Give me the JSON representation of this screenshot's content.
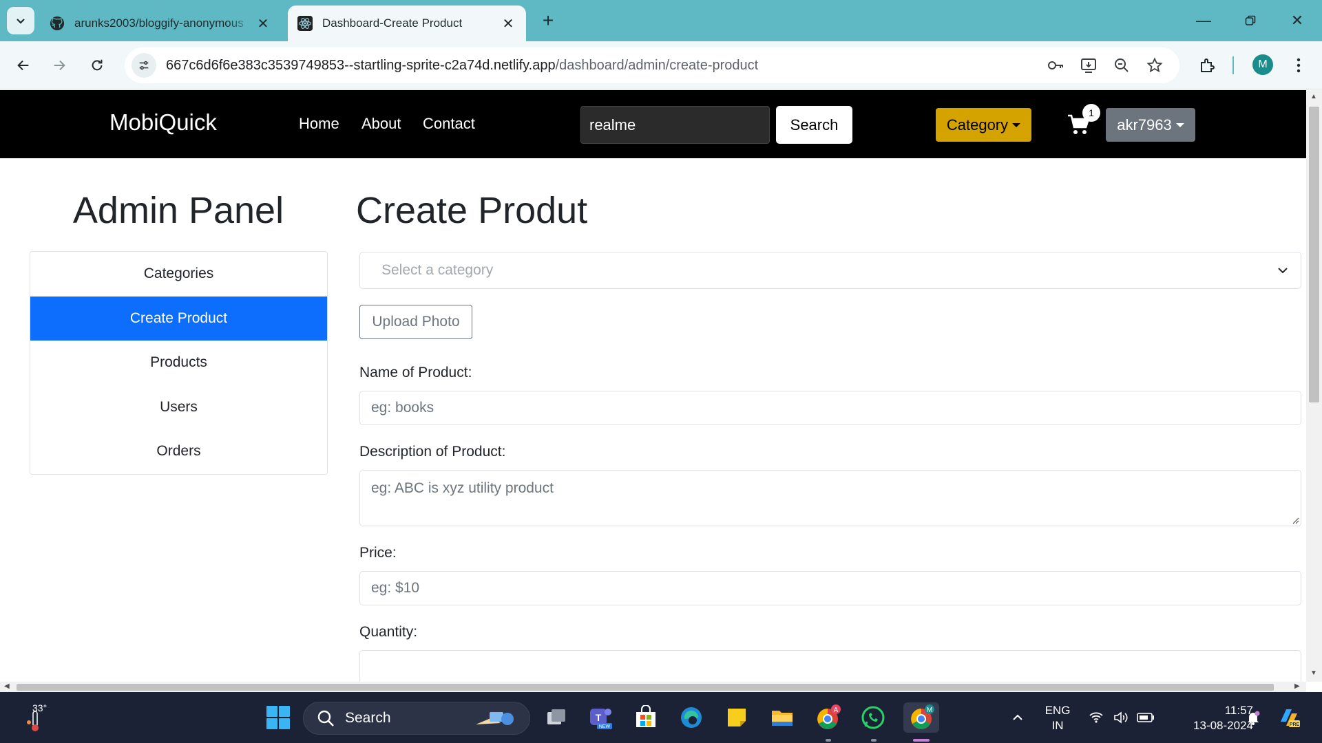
{
  "browser": {
    "tabs": [
      {
        "title": "arunks2003/bloggify-anonymous",
        "icon": "github-icon",
        "active": false
      },
      {
        "title": "Dashboard-Create Product",
        "icon": "react-icon",
        "active": true
      }
    ],
    "url_host": "667c6d6f6e383c3539749853--startling-sprite-c2a74d.netlify.app",
    "url_path": "/dashboard/admin/create-product",
    "profile_initial": "M"
  },
  "navbar": {
    "brand": "MobiQuick",
    "links": [
      "Home",
      "About",
      "Contact"
    ],
    "search_value": "realme",
    "search_button": "Search",
    "category_button": "Category",
    "cart_count": "1",
    "user_button": "akr7963"
  },
  "sidebar": {
    "title": "Admin Panel",
    "items": [
      {
        "label": "Categories",
        "active": false
      },
      {
        "label": "Create Product",
        "active": true
      },
      {
        "label": "Products",
        "active": false
      },
      {
        "label": "Users",
        "active": false
      },
      {
        "label": "Orders",
        "active": false
      }
    ]
  },
  "form": {
    "title": "Create Produt",
    "category_placeholder": "Select a category",
    "upload_button": "Upload Photo",
    "name_label": "Name of Product:",
    "name_placeholder": "eg: books",
    "description_label": "Description of Product:",
    "description_placeholder": "eg: ABC is xyz utility product",
    "price_label": "Price:",
    "price_placeholder": "eg: $10",
    "quantity_label": "Quantity:",
    "quantity_placeholder": ""
  },
  "taskbar": {
    "temperature": "33°",
    "search_label": "Search",
    "language_line1": "ENG",
    "language_line2": "IN",
    "time": "11:57",
    "date": "13-08-2024"
  },
  "colors": {
    "browser_accent": "#5eb9c4",
    "navbar_bg": "#000000",
    "active_item": "#0d6efd",
    "category_button": "#d4a300",
    "user_button": "#6c757d"
  }
}
